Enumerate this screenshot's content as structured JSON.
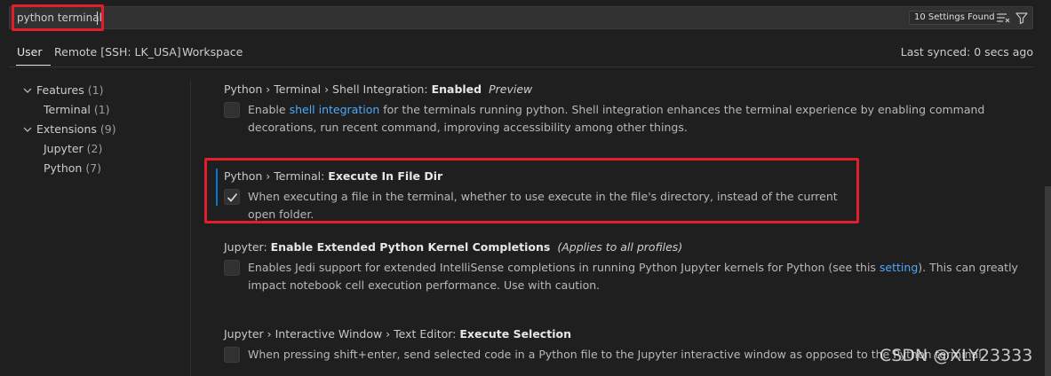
{
  "search": {
    "value": "python terminal",
    "results_count": "10 Settings Found",
    "icons": [
      "clear-filter-icon",
      "filter-icon"
    ]
  },
  "tabs": [
    {
      "label": "User",
      "active": true
    },
    {
      "label": "Remote [SSH: LK_USA]",
      "active": false
    },
    {
      "label": "Workspace",
      "active": false
    }
  ],
  "sync_status": "Last synced: 0 secs ago",
  "toc": [
    {
      "label": "Features",
      "count": "(1)",
      "expanded": true
    },
    {
      "label": "Terminal",
      "count": "(1)"
    },
    {
      "label": "Extensions",
      "count": "(9)",
      "expanded": true
    },
    {
      "label": "Jupyter",
      "count": "(2)"
    },
    {
      "label": "Python",
      "count": "(7)"
    }
  ],
  "settings": [
    {
      "category": "Python › Terminal › Shell Integration: ",
      "name": "Enabled",
      "tag": "Preview",
      "desc_before": "Enable ",
      "desc_link": "shell integration",
      "desc_after": " for the terminals running python. Shell integration enhances the terminal experience by enabling command decorations, run recent command, improving accessibility among other things.",
      "checked": false
    },
    {
      "category": "Python › Terminal: ",
      "name": "Execute In File Dir",
      "desc": "When executing a file in the terminal, whether to use execute in the file's directory, instead of the current open folder.",
      "checked": true
    },
    {
      "category": "Jupyter: ",
      "name": "Enable Extended Python Kernel Completions",
      "tag": "(Applies to all profiles)",
      "desc_before": "Enables Jedi support for extended IntelliSense completions in running Python Jupyter kernels for Python (see this ",
      "desc_link": "setting",
      "desc_after": "). This can greatly impact notebook cell execution performance. Use with caution.",
      "checked": false
    },
    {
      "category": "Jupyter › Interactive Window › Text Editor: ",
      "name": "Execute Selection",
      "desc": "When pressing shift+enter, send selected code in a Python file to the Jupyter interactive window as opposed to the Python terminal.",
      "checked": false
    }
  ],
  "watermark": "CSDN @XLY23333",
  "colors": {
    "background": "#1f1f1f",
    "highlight_box": "#e01f2a",
    "link": "#4daafc",
    "focus_bar": "#0078d4"
  }
}
